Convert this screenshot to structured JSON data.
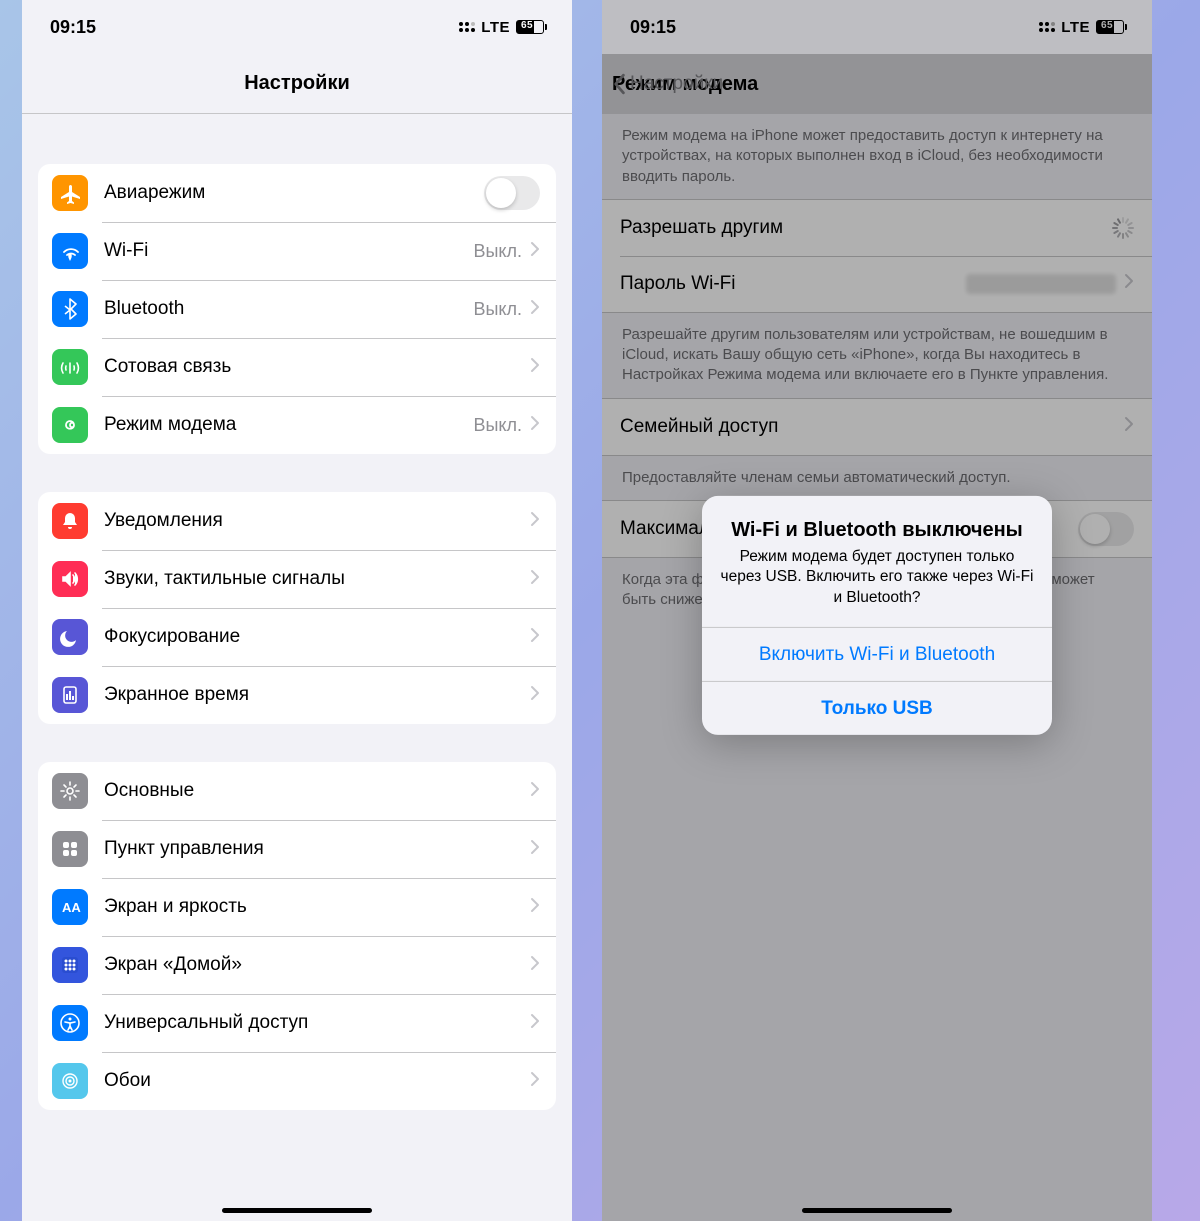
{
  "statusbar": {
    "time": "09:15",
    "network": "LTE",
    "battery": "65"
  },
  "left": {
    "title": "Настройки",
    "groups": [
      [
        {
          "icon": "airplane",
          "label": "Авиарежим",
          "toggle": false
        },
        {
          "icon": "wifi",
          "label": "Wi-Fi",
          "value": "Выкл."
        },
        {
          "icon": "bluetooth",
          "label": "Bluetooth",
          "value": "Выкл."
        },
        {
          "icon": "cellular",
          "label": "Сотовая связь"
        },
        {
          "icon": "hotspot",
          "label": "Режим модема",
          "value": "Выкл."
        }
      ],
      [
        {
          "icon": "notifications",
          "label": "Уведомления"
        },
        {
          "icon": "sounds",
          "label": "Звуки, тактильные сигналы"
        },
        {
          "icon": "focus",
          "label": "Фокусирование"
        },
        {
          "icon": "screentime",
          "label": "Экранное время"
        }
      ],
      [
        {
          "icon": "general",
          "label": "Основные"
        },
        {
          "icon": "controlcenter",
          "label": "Пункт управления"
        },
        {
          "icon": "display",
          "label": "Экран и яркость"
        },
        {
          "icon": "homescreen",
          "label": "Экран «Домой»"
        },
        {
          "icon": "accessibility",
          "label": "Универсальный доступ"
        },
        {
          "icon": "wallpaper",
          "label": "Обои"
        }
      ]
    ]
  },
  "right": {
    "back": "Настройки",
    "title": "Режим модема",
    "intro": "Режим модема на iPhone может предоставить доступ к интернету на устройствах, на которых выполнен вход в iCloud, без необходимости вводить пароль.",
    "rows": {
      "allow": "Разрешать другим",
      "password": "Пароль Wi-Fi"
    },
    "explain": "Разрешайте другим пользователям или устройствам, не вошедшим в iCloud, искать Вашу общую сеть «iPhone», когда Вы находитесь в Настройках Режима модема или включаете его в Пункте управления.",
    "family": "Семейный доступ",
    "family_sub": "Предоставляйте членам семьи автоматический доступ.",
    "compat": "Максимальная совместимость",
    "compat_sub": "Когда эта функция включена, скорость интернет-соединения может быть снижена для устройств, подключенных к точке доступа."
  },
  "alert": {
    "title": "Wi-Fi и Bluetooth выключены",
    "message": "Режим модема будет доступен только через USB. Включить его также через Wi-Fi и Bluetooth?",
    "btn1": "Включить Wi-Fi и Bluetooth",
    "btn2": "Только USB"
  },
  "icon_colors": {
    "airplane": "#ff9500",
    "wifi": "#007aff",
    "bluetooth": "#007aff",
    "cellular": "#34c759",
    "hotspot": "#34c759",
    "notifications": "#ff3b30",
    "sounds": "#ff2d55",
    "focus": "#5856d6",
    "screentime": "#5856d6",
    "general": "#8e8e93",
    "controlcenter": "#8e8e93",
    "display": "#007aff",
    "homescreen": "#3355dd",
    "accessibility": "#007aff",
    "wallpaper": "#54c7ec"
  }
}
